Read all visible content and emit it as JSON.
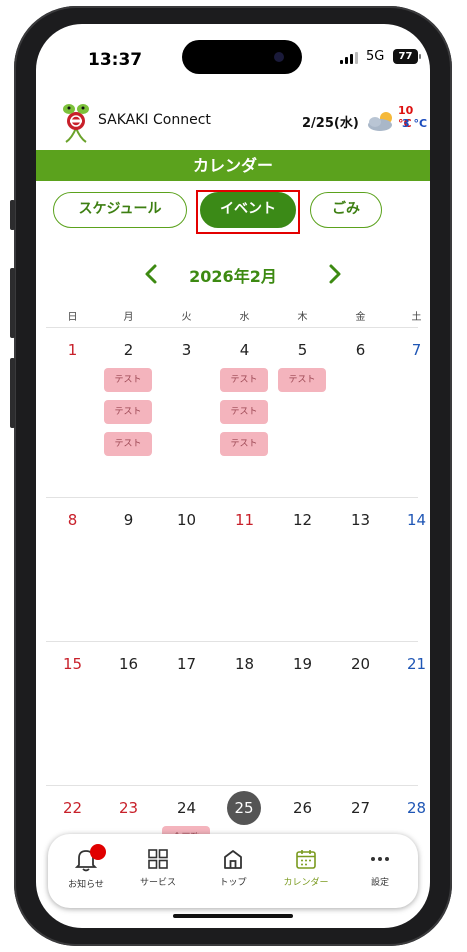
{
  "status": {
    "time": "13:37",
    "network": "5G",
    "battery": "77"
  },
  "app": {
    "title": "SAKAKI Connect",
    "date": "2/25(水)",
    "temp_high": "10 °C",
    "temp_low": "3 °C"
  },
  "page_title": "カレンダー",
  "tabs": [
    {
      "label": "スケジュール",
      "active": false
    },
    {
      "label": "イベント",
      "active": true
    },
    {
      "label": "ごみ",
      "active": false
    }
  ],
  "calendar": {
    "month_label": "2026年2月",
    "weekdays": [
      "日",
      "月",
      "火",
      "水",
      "木",
      "金",
      "土"
    ],
    "weeks": [
      {
        "days": [
          "1",
          "2",
          "3",
          "4",
          "5",
          "6",
          "7"
        ]
      },
      {
        "days": [
          "8",
          "9",
          "10",
          "11",
          "12",
          "13",
          "14"
        ]
      },
      {
        "days": [
          "15",
          "16",
          "17",
          "18",
          "19",
          "20",
          "21"
        ]
      },
      {
        "days": [
          "22",
          "23",
          "24",
          "25",
          "26",
          "27",
          "28"
        ]
      }
    ],
    "events": [
      {
        "day": "2",
        "label": "テスト"
      },
      {
        "day": "2",
        "label": "テスト"
      },
      {
        "day": "2",
        "label": "テスト"
      },
      {
        "day": "4",
        "label": "テスト"
      },
      {
        "day": "4",
        "label": "テスト"
      },
      {
        "day": "4",
        "label": "テスト"
      },
      {
        "day": "5",
        "label": "テスト"
      },
      {
        "day": "24",
        "label": "企画政"
      }
    ],
    "today": "25",
    "holidays": [
      "11",
      "23"
    ]
  },
  "nav": [
    {
      "label": "お知らせ",
      "icon": "bell-icon",
      "badge": true
    },
    {
      "label": "サービス",
      "icon": "grid-icon"
    },
    {
      "label": "トップ",
      "icon": "home-icon"
    },
    {
      "label": "カレンダー",
      "icon": "calendar-icon",
      "active": true
    },
    {
      "label": "設定",
      "icon": "more-icon"
    }
  ],
  "colors": {
    "brand_green": "#5ba21d",
    "active_tab": "#3b8a17",
    "event_pink": "#f4b4bd",
    "sunday_red": "#c8202a",
    "saturday_blue": "#1f56b5",
    "highlight_red": "#e30000"
  }
}
